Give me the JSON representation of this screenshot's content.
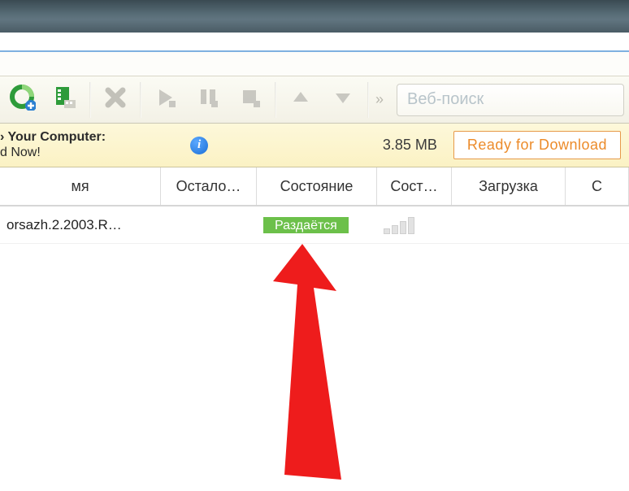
{
  "toolbar": {
    "search_placeholder": "Веб-поиск"
  },
  "infobar": {
    "line1": "› Your Computer:",
    "line2": "d Now!",
    "size": "3.85 MB",
    "ready_label": "Ready for Download",
    "info_glyph": "i"
  },
  "columns": {
    "name": "мя",
    "remaining": "Остало…",
    "state": "Состояние",
    "state2": "Сост…",
    "download": "Загрузка",
    "last": "С"
  },
  "row": {
    "name": "orsazh.2.2003.R…",
    "state_badge": "Раздаётся"
  },
  "icons": {
    "add": "add-torrent-icon",
    "addfile": "add-file-icon",
    "remove": "remove-icon",
    "play": "play-icon",
    "pause": "pause-icon",
    "stop": "stop-icon",
    "up": "move-up-icon",
    "down": "move-down-icon",
    "more": "more-icon"
  }
}
